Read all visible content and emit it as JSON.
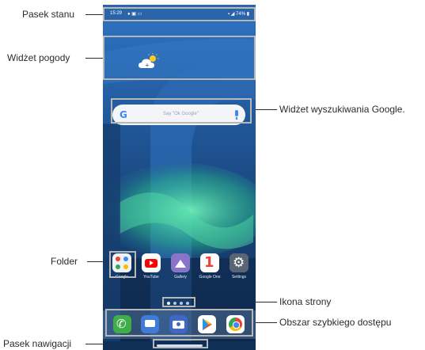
{
  "callouts": {
    "status_bar": "Pasek stanu",
    "weather_widget": "Widżet pogody",
    "google_search_widget": "Widżet wyszukiwania Google.",
    "folder": "Folder",
    "page_icon": "Ikona strony",
    "quick_access_area": "Obszar szybkiego dostępu",
    "navigation_bar": "Pasek nawigacji"
  },
  "status_bar": {
    "time": "15:29",
    "battery": "74%"
  },
  "search_widget": {
    "logo": "G",
    "hint": "Say \"Ok Google\""
  },
  "home_apps": [
    {
      "label": "Google",
      "color": "#ffffff"
    },
    {
      "label": "YouTube",
      "color": "#ffffff"
    },
    {
      "label": "Gallery",
      "color": "#8a74c9"
    },
    {
      "label": "Google One",
      "color": "#ffffff"
    },
    {
      "label": "Settings",
      "color": "#5b6472"
    }
  ],
  "dock_apps": [
    {
      "name": "phone-icon",
      "color": "#3fae49"
    },
    {
      "name": "messages-icon",
      "color": "#3f7bd8"
    },
    {
      "name": "camera-icon",
      "color": "#3f68c4"
    },
    {
      "name": "play-store-icon",
      "color": "#ffffff"
    },
    {
      "name": "chrome-icon",
      "color": "#ffffff"
    }
  ],
  "page_indicator": {
    "pages": 4,
    "current": 1
  },
  "colors": {
    "highlight": "#b7b7b7",
    "wallpaper_sky": "#1e4d86",
    "aurora": "#2fbf8a"
  }
}
